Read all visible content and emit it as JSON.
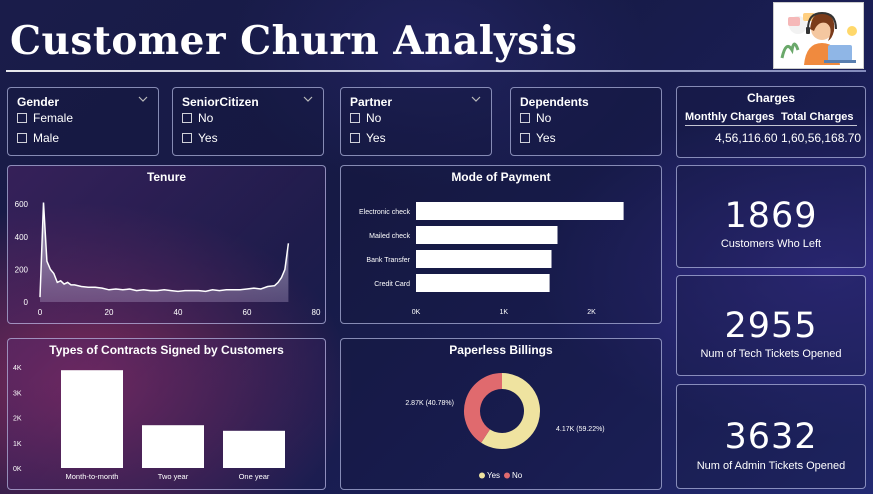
{
  "header": {
    "title": "Customer Churn Analysis"
  },
  "slicers": [
    {
      "title": "Gender",
      "options": [
        "Female",
        "Male"
      ]
    },
    {
      "title": "SeniorCitizen",
      "options": [
        "No",
        "Yes"
      ]
    },
    {
      "title": "Partner",
      "options": [
        "No",
        "Yes"
      ]
    },
    {
      "title": "Dependents",
      "options": [
        "No",
        "Yes"
      ]
    }
  ],
  "charges": {
    "title": "Charges",
    "monthly_label": "Monthly Charges",
    "total_label": "Total Charges",
    "monthly_value": "4,56,116.60",
    "total_value": "1,60,56,168.70"
  },
  "kpis": [
    {
      "value": "1869",
      "label": "Customers Who Left"
    },
    {
      "value": "2955",
      "label": "Num of Tech Tickets Opened"
    },
    {
      "value": "3632",
      "label": "Num of Admin Tickets Opened"
    }
  ],
  "icons": {
    "slicer_chevron": "chevron-down-icon",
    "logo": "support-agent-illustration"
  },
  "colors": {
    "bar": "#ffffff",
    "donut_yes": "#efe3a0",
    "donut_no": "#e06a6e"
  },
  "chart_data": [
    {
      "type": "area",
      "title": "Tenure",
      "x": [
        0,
        1,
        2,
        3,
        4,
        5,
        6,
        7,
        8,
        9,
        10,
        12,
        14,
        16,
        18,
        20,
        22,
        24,
        26,
        28,
        30,
        32,
        34,
        36,
        38,
        40,
        42,
        44,
        46,
        48,
        50,
        52,
        54,
        56,
        58,
        60,
        62,
        64,
        66,
        68,
        69,
        70,
        71,
        72
      ],
      "y": [
        30,
        610,
        250,
        200,
        175,
        120,
        130,
        110,
        120,
        105,
        105,
        95,
        90,
        90,
        85,
        75,
        80,
        75,
        80,
        70,
        75,
        70,
        70,
        75,
        70,
        65,
        70,
        70,
        70,
        65,
        75,
        70,
        75,
        75,
        75,
        80,
        85,
        80,
        95,
        100,
        120,
        150,
        200,
        360
      ],
      "xticks": [
        0,
        20,
        40,
        60,
        80
      ],
      "yticks": [
        0,
        200,
        400,
        600
      ],
      "xlim": [
        0,
        80
      ],
      "ylim": [
        0,
        650
      ]
    },
    {
      "type": "bar",
      "orientation": "horizontal",
      "title": "Mode of Payment",
      "categories": [
        "Electronic check",
        "Mailed check",
        "Bank Transfer",
        "Credit Card"
      ],
      "values": [
        2365,
        1612,
        1544,
        1522
      ],
      "xticks": [
        "0K",
        "1K",
        "2K"
      ],
      "tick_values": [
        0,
        1000,
        2000
      ],
      "xlim": [
        0,
        2700
      ]
    },
    {
      "type": "bar",
      "title": "Types of Contracts Signed by Customers",
      "categories": [
        "Month-to-month",
        "Two year",
        "One year"
      ],
      "values": [
        3875,
        1695,
        1473
      ],
      "yticks": [
        "0K",
        "1K",
        "2K",
        "3K",
        "4K"
      ],
      "tick_values": [
        0,
        1000,
        2000,
        3000,
        4000
      ],
      "ylim": [
        0,
        4000
      ]
    },
    {
      "type": "pie",
      "variant": "donut",
      "title": "Paperless Billings",
      "labels": [
        "Yes",
        "No"
      ],
      "values": [
        4170,
        2870
      ],
      "data_labels": [
        "4.17K (59.22%)",
        "2.87K (40.78%)"
      ],
      "legend": "bottom"
    }
  ]
}
